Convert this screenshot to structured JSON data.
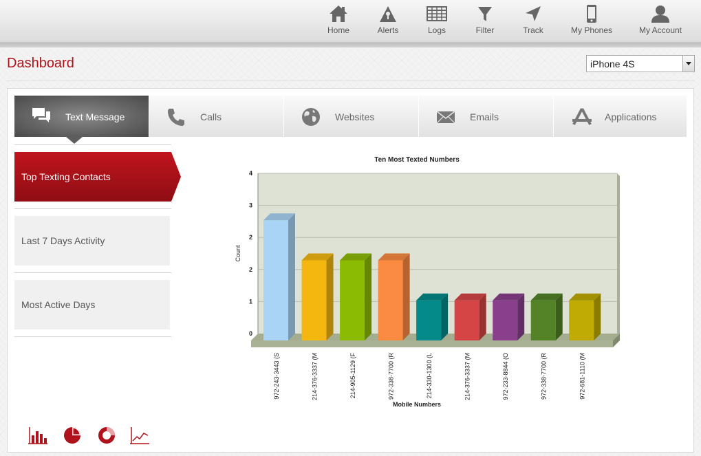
{
  "nav": {
    "items": [
      {
        "label": "Home",
        "icon": "home-icon"
      },
      {
        "label": "Alerts",
        "icon": "alert-icon"
      },
      {
        "label": "Logs",
        "icon": "logs-icon"
      },
      {
        "label": "Filter",
        "icon": "filter-icon"
      },
      {
        "label": "Track",
        "icon": "track-icon"
      },
      {
        "label": "My Phones",
        "icon": "phone-icon"
      },
      {
        "label": "My Account",
        "icon": "account-icon"
      }
    ]
  },
  "page": {
    "title": "Dashboard"
  },
  "device_select": {
    "value": "iPhone 4S"
  },
  "tabs": [
    {
      "label": "Text Message",
      "icon": "chat-icon",
      "active": true
    },
    {
      "label": "Calls",
      "icon": "phone-handset-icon"
    },
    {
      "label": "Websites",
      "icon": "globe-icon"
    },
    {
      "label": "Emails",
      "icon": "envelope-icon"
    },
    {
      "label": "Applications",
      "icon": "app-store-icon"
    }
  ],
  "sidebar": {
    "items": [
      {
        "label": "Top Texting Contacts",
        "active": true
      },
      {
        "label": "Last 7 Days Activity"
      },
      {
        "label": "Most Active Days"
      }
    ]
  },
  "chart_toggles": [
    "bar-chart-icon",
    "pie-chart-icon",
    "donut-chart-icon",
    "line-chart-icon"
  ],
  "colors": {
    "accent": "#b0121c",
    "plot_bg": "#dde2d4"
  },
  "chart_data": {
    "type": "bar",
    "title": "Ten Most Texted Numbers",
    "xlabel": "Mobile Numbers",
    "ylabel": "Count",
    "ytick_labels": [
      "0",
      "1",
      "2",
      "2",
      "3",
      "4"
    ],
    "ylim": [
      0,
      4
    ],
    "grid": true,
    "categories": [
      "972-243-3443 (S",
      "214-376-3337 (M",
      "214-905-1129 (F",
      "972-338-7700 (R",
      "214-330-1300 (L",
      "214-376-3337 (M",
      "972-233-8844 (O",
      "972-338-7700 (R",
      "972-681-1110 (M"
    ],
    "values": [
      3,
      2,
      2,
      2,
      1,
      1,
      1,
      1,
      1
    ],
    "bar_colors": [
      "#a9d4f5",
      "#f3b70f",
      "#8cbb04",
      "#fb8b43",
      "#058a8a",
      "#d64546",
      "#8a3f8d",
      "#548327",
      "#bfab03"
    ]
  }
}
